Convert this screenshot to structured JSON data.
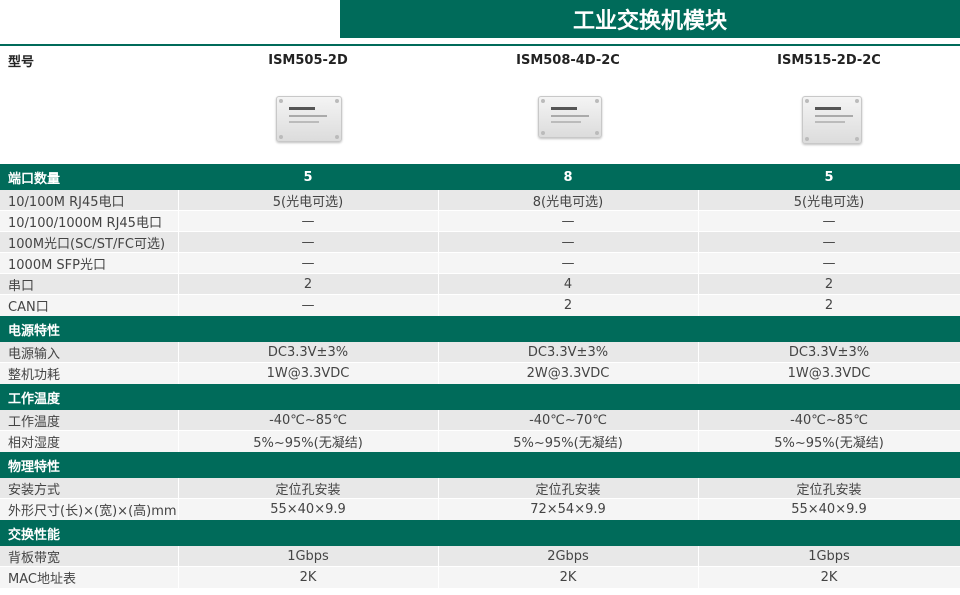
{
  "title": "工业交换机模块",
  "header": {
    "label": "型号",
    "models": [
      "ISM505-2D",
      "ISM508-4D-2C",
      "ISM515-2D-2C"
    ]
  },
  "sections": [
    {
      "name": "端口数量",
      "values": [
        "5",
        "8",
        "5"
      ],
      "rows": [
        {
          "label": "10/100M RJ45电口",
          "values": [
            "5(光电可选)",
            "8(光电可选)",
            "5(光电可选)"
          ]
        },
        {
          "label": "10/100/1000M RJ45电口",
          "values": [
            "—",
            "—",
            "—"
          ]
        },
        {
          "label": "100M光口(SC/ST/FC可选)",
          "values": [
            "—",
            "—",
            "—"
          ]
        },
        {
          "label": "1000M SFP光口",
          "values": [
            "—",
            "—",
            "—"
          ]
        },
        {
          "label": "串口",
          "values": [
            "2",
            "4",
            "2"
          ]
        },
        {
          "label": "CAN口",
          "values": [
            "—",
            "2",
            "2"
          ]
        }
      ]
    },
    {
      "name": "电源特性",
      "values": [
        "",
        "",
        ""
      ],
      "rows": [
        {
          "label": "电源输入",
          "values": [
            "DC3.3V±3%",
            "DC3.3V±3%",
            "DC3.3V±3%"
          ]
        },
        {
          "label": "整机功耗",
          "values": [
            "1W@3.3VDC",
            "2W@3.3VDC",
            "1W@3.3VDC"
          ]
        }
      ]
    },
    {
      "name": "工作温度",
      "values": [
        "",
        "",
        ""
      ],
      "rows": [
        {
          "label": "工作温度",
          "values": [
            "-40℃~85℃",
            "-40℃~70℃",
            "-40℃~85℃"
          ]
        },
        {
          "label": "相对湿度",
          "values": [
            "5%~95%(无凝结)",
            "5%~95%(无凝结)",
            "5%~95%(无凝结)"
          ]
        }
      ]
    },
    {
      "name": "物理特性",
      "values": [
        "",
        "",
        ""
      ],
      "rows": [
        {
          "label": "安装方式",
          "values": [
            "定位孔安装",
            "定位孔安装",
            "定位孔安装"
          ]
        },
        {
          "label": "外形尺寸(长)×(宽)×(高)mm",
          "values": [
            "55×40×9.9",
            "72×54×9.9",
            "55×40×9.9"
          ]
        }
      ]
    },
    {
      "name": "交换性能",
      "values": [
        "",
        "",
        ""
      ],
      "rows": [
        {
          "label": "背板带宽",
          "values": [
            "1Gbps",
            "2Gbps",
            "1Gbps"
          ]
        },
        {
          "label": "MAC地址表",
          "values": [
            "2K",
            "2K",
            "2K"
          ]
        }
      ]
    }
  ],
  "colors": {
    "accent": "#006b5a",
    "row_bg": "#e8e8e8",
    "row_bg_alt": "#f5f5f5"
  }
}
